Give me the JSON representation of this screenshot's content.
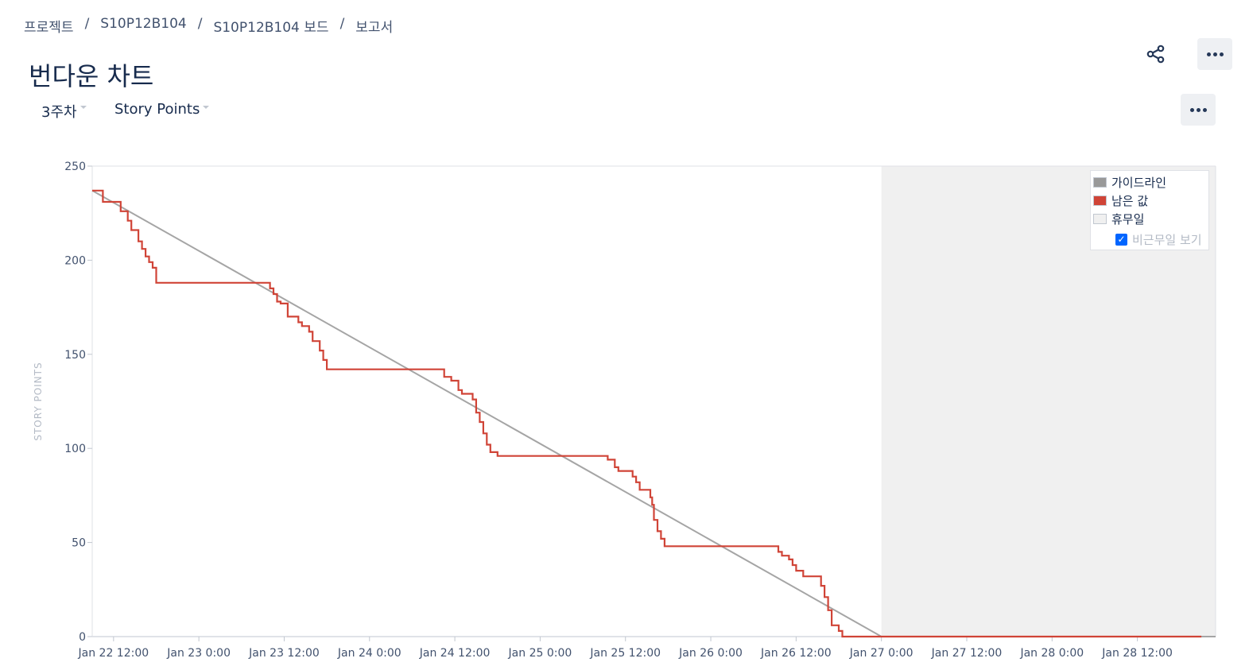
{
  "breadcrumb": [
    "프로젝트",
    "S10P12B104",
    "S10P12B104 보드",
    "보고서"
  ],
  "page_title": "번다운 차트",
  "filters": {
    "sprint": "3주차",
    "metric": "Story Points"
  },
  "icons": {
    "share": "share-icon",
    "more": "more-icon"
  },
  "colors": {
    "guideline": "#a5a5a5",
    "remaining": "#d04437",
    "non_working": "#f0f0f0",
    "accent": "#0065ff"
  },
  "legend": {
    "guideline": "가이드라인",
    "remaining": "남은 값",
    "non_working": "휴무일",
    "show_non_working": "비근무일 보기",
    "show_non_working_checked": true
  },
  "chart_data": {
    "type": "line",
    "title": "",
    "xlabel": "",
    "ylabel": "STORY POINTS",
    "ylim": [
      0,
      250
    ],
    "y_ticks": [
      0,
      50,
      100,
      150,
      200,
      250
    ],
    "x_range": [
      "Jan 22 9:00",
      "Jan 28 23:00"
    ],
    "x_ticks": [
      "Jan 22 12:00",
      "Jan 23 0:00",
      "Jan 23 12:00",
      "Jan 24 0:00",
      "Jan 24 12:00",
      "Jan 25 0:00",
      "Jan 25 12:00",
      "Jan 26 0:00",
      "Jan 26 12:00",
      "Jan 27 0:00",
      "Jan 27 12:00",
      "Jan 28 0:00",
      "Jan 28 12:00"
    ],
    "non_working_period": [
      "Jan 27 0:00",
      "Jan 28 23:00"
    ],
    "grid": false,
    "legend_position": "top-right",
    "series": [
      {
        "name": "가이드라인",
        "points": [
          [
            "Jan 22 9:00",
            237
          ],
          [
            "Jan 27 0:00",
            0
          ],
          [
            "Jan 28 23:00",
            0
          ]
        ]
      },
      {
        "name": "남은 값",
        "step": true,
        "points": [
          [
            "Jan 22 9:00",
            237
          ],
          [
            "Jan 22 10:30",
            231
          ],
          [
            "Jan 22 13:00",
            226
          ],
          [
            "Jan 22 14:00",
            221
          ],
          [
            "Jan 22 14:30",
            216
          ],
          [
            "Jan 22 15:30",
            210
          ],
          [
            "Jan 22 16:00",
            206
          ],
          [
            "Jan 22 16:30",
            202
          ],
          [
            "Jan 22 17:00",
            199
          ],
          [
            "Jan 22 17:30",
            196
          ],
          [
            "Jan 22 18:00",
            188
          ],
          [
            "Jan 23 10:00",
            185
          ],
          [
            "Jan 23 10:30",
            182
          ],
          [
            "Jan 23 11:00",
            178
          ],
          [
            "Jan 23 11:30",
            177
          ],
          [
            "Jan 23 12:30",
            170
          ],
          [
            "Jan 23 14:00",
            167
          ],
          [
            "Jan 23 14:30",
            165
          ],
          [
            "Jan 23 15:30",
            162
          ],
          [
            "Jan 23 16:00",
            157
          ],
          [
            "Jan 23 17:00",
            152
          ],
          [
            "Jan 23 17:30",
            147
          ],
          [
            "Jan 23 18:00",
            142
          ],
          [
            "Jan 24 10:30",
            138
          ],
          [
            "Jan 24 11:30",
            136
          ],
          [
            "Jan 24 12:30",
            131
          ],
          [
            "Jan 24 13:00",
            129
          ],
          [
            "Jan 24 14:30",
            126
          ],
          [
            "Jan 24 15:00",
            119
          ],
          [
            "Jan 24 15:30",
            114
          ],
          [
            "Jan 24 16:00",
            108
          ],
          [
            "Jan 24 16:30",
            102
          ],
          [
            "Jan 24 17:00",
            98
          ],
          [
            "Jan 24 18:00",
            96
          ],
          [
            "Jan 25 9:30",
            94
          ],
          [
            "Jan 25 10:30",
            90
          ],
          [
            "Jan 25 11:00",
            88
          ],
          [
            "Jan 25 13:00",
            85
          ],
          [
            "Jan 25 13:30",
            82
          ],
          [
            "Jan 25 14:00",
            78
          ],
          [
            "Jan 25 15:30",
            74
          ],
          [
            "Jan 25 15:45",
            70
          ],
          [
            "Jan 25 16:00",
            62
          ],
          [
            "Jan 25 16:30",
            56
          ],
          [
            "Jan 25 17:00",
            52
          ],
          [
            "Jan 25 17:30",
            48
          ],
          [
            "Jan 26 9:30",
            45
          ],
          [
            "Jan 26 10:00",
            43
          ],
          [
            "Jan 26 11:00",
            41
          ],
          [
            "Jan 26 11:30",
            38
          ],
          [
            "Jan 26 12:00",
            35
          ],
          [
            "Jan 26 13:00",
            32
          ],
          [
            "Jan 26 15:30",
            27
          ],
          [
            "Jan 26 16:00",
            21
          ],
          [
            "Jan 26 16:30",
            14
          ],
          [
            "Jan 26 17:00",
            6
          ],
          [
            "Jan 26 18:00",
            3
          ],
          [
            "Jan 26 18:30",
            0
          ],
          [
            "Jan 28 21:00",
            0
          ]
        ]
      }
    ]
  }
}
